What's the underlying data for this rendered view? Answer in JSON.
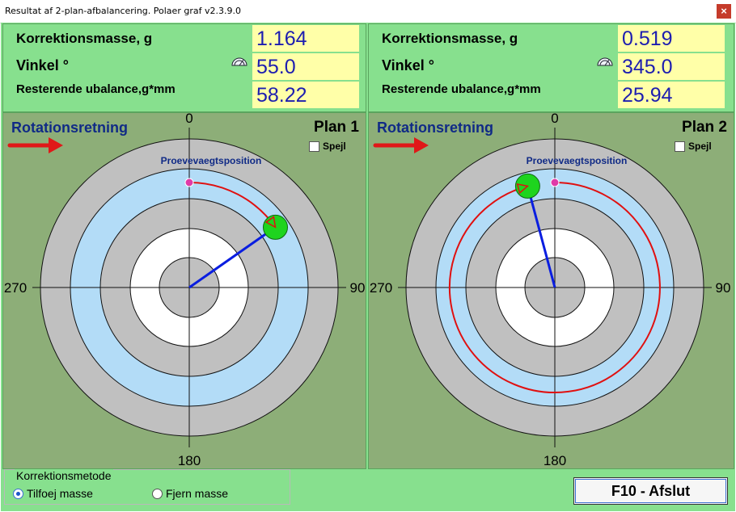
{
  "window": {
    "title": "Resultat af 2-plan-afbalancering. Polaer graf v2.3.9.0",
    "close_glyph": "×"
  },
  "labels": {
    "mass": "Korrektionsmasse, g",
    "angle": "Vinkel  °",
    "residual": "Resterende ubalance,g*mm"
  },
  "planes": [
    {
      "mass": "1.164",
      "angle": "55.0",
      "residual": "58.22",
      "rotation_label": "Rotationsretning",
      "plan_label": "Plan 1",
      "mirror_label": "Spejl",
      "mirror_checked": false,
      "trial_label": "Proevevaegtsposition",
      "angle_deg": 55,
      "arc_radius": 4,
      "axis_labels": [
        "0",
        "90",
        "180",
        "270"
      ]
    },
    {
      "mass": "0.519",
      "angle": "345.0",
      "residual": "25.94",
      "rotation_label": "Rotationsretning",
      "plan_label": "Plan 2",
      "mirror_label": "Spejl",
      "mirror_checked": false,
      "trial_label": "Proevevaegtsposition",
      "angle_deg": 345,
      "arc_radius": 4,
      "axis_labels": [
        "0",
        "90",
        "180",
        "270"
      ]
    }
  ],
  "method": {
    "title": "Korrektionsmetode",
    "option_add": "Tilfoej masse",
    "option_remove": "Fjern masse",
    "selected": "Tilfoej masse"
  },
  "exit_button": "F10 - Afslut",
  "colors": {
    "background": "#87e08e",
    "plot_background": "#8dae78",
    "ring_gray": "#c0c0c0",
    "ring_blue": "#b3dcf7",
    "ring_white": "#ffffff",
    "value_box": "#ffffa8",
    "value_text": "#1d1db0",
    "arc": "#e01010",
    "vector": "#0a1ee0",
    "weight": "#1ed41e",
    "trial_marker": "#e03aa8"
  }
}
